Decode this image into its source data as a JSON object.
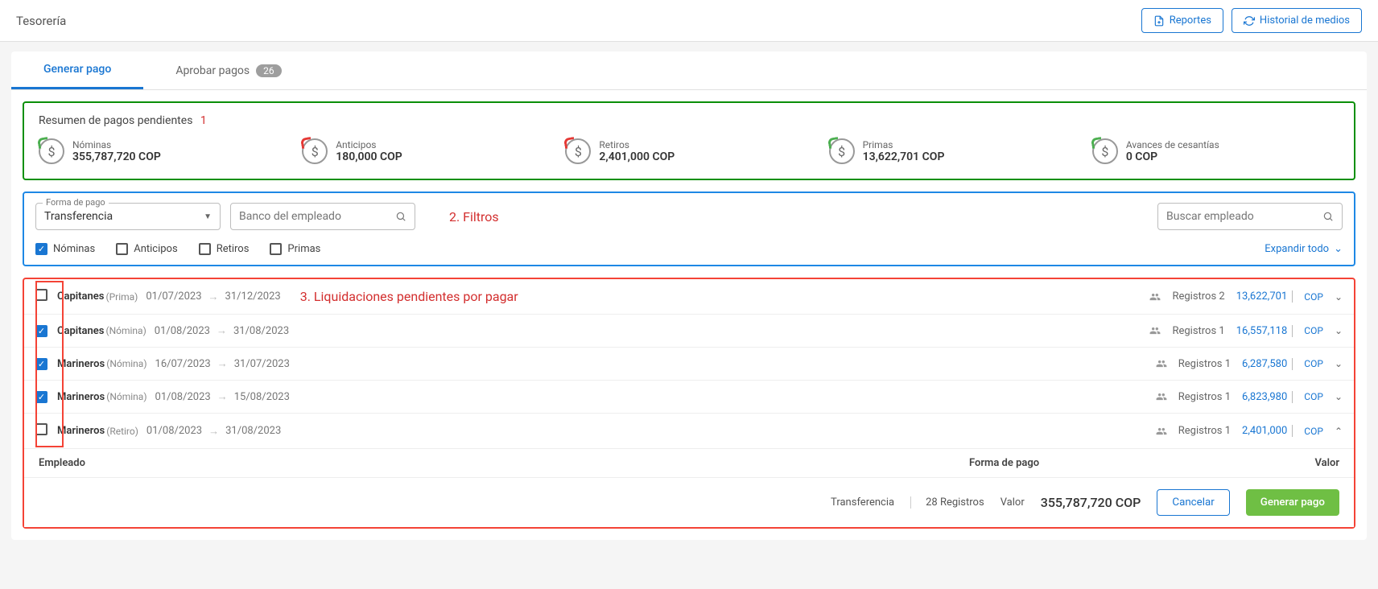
{
  "header": {
    "title": "Tesorería",
    "buttons": {
      "reports": "Reportes",
      "history": "Historial de medios"
    }
  },
  "tabs": {
    "generate": "Generar pago",
    "approve": "Aprobar pagos",
    "approve_count": "26"
  },
  "annotations": {
    "a1": "1",
    "a2": "2. Filtros",
    "a3": "3. Liquidaciones pendientes por pagar"
  },
  "summary": {
    "title": "Resumen de pagos pendientes",
    "items": [
      {
        "label": "Nóminas",
        "value": "355,787,720 COP",
        "red": false
      },
      {
        "label": "Anticipos",
        "value": "180,000 COP",
        "red": true
      },
      {
        "label": "Retiros",
        "value": "2,401,000 COP",
        "red": true
      },
      {
        "label": "Primas",
        "value": "13,622,701 COP",
        "red": false
      },
      {
        "label": "Avances de cesantías",
        "value": "0 COP",
        "red": false
      }
    ]
  },
  "filters": {
    "payment_method_label": "Forma de pago",
    "payment_method_value": "Transferencia",
    "bank_placeholder": "Banco del empleado",
    "search_placeholder": "Buscar empleado",
    "checks": {
      "nominas": "Nóminas",
      "anticipos": "Anticipos",
      "retiros": "Retiros",
      "primas": "Primas"
    },
    "expand_all": "Expandir todo"
  },
  "rows": [
    {
      "checked": false,
      "group": "Capitanes",
      "type": "(Prima)",
      "from": "01/07/2023",
      "to": "31/12/2023",
      "reg": "Registros 2",
      "amount": "13,622,701",
      "cur": "COP",
      "expanded": false,
      "annot": true
    },
    {
      "checked": true,
      "group": "Capitanes",
      "type": "(Nómina)",
      "from": "01/08/2023",
      "to": "31/08/2023",
      "reg": "Registros 1",
      "amount": "16,557,118",
      "cur": "COP",
      "expanded": false,
      "annot": false
    },
    {
      "checked": true,
      "group": "Marineros",
      "type": "(Nómina)",
      "from": "16/07/2023",
      "to": "31/07/2023",
      "reg": "Registros 1",
      "amount": "6,287,580",
      "cur": "COP",
      "expanded": false,
      "annot": false
    },
    {
      "checked": true,
      "group": "Marineros",
      "type": "(Nómina)",
      "from": "01/08/2023",
      "to": "15/08/2023",
      "reg": "Registros 1",
      "amount": "6,823,980",
      "cur": "COP",
      "expanded": false,
      "annot": false
    },
    {
      "checked": false,
      "group": "Marineros",
      "type": "(Retiro)",
      "from": "01/08/2023",
      "to": "31/08/2023",
      "reg": "Registros 1",
      "amount": "2,401,000",
      "cur": "COP",
      "expanded": true,
      "annot": false
    }
  ],
  "detail_headers": {
    "employee": "Empleado",
    "method": "Forma de pago",
    "value": "Valor"
  },
  "footer": {
    "method": "Transferencia",
    "records": "28 Registros",
    "value_label": "Valor",
    "value": "355,787,720 COP",
    "cancel": "Cancelar",
    "generate": "Generar pago"
  }
}
